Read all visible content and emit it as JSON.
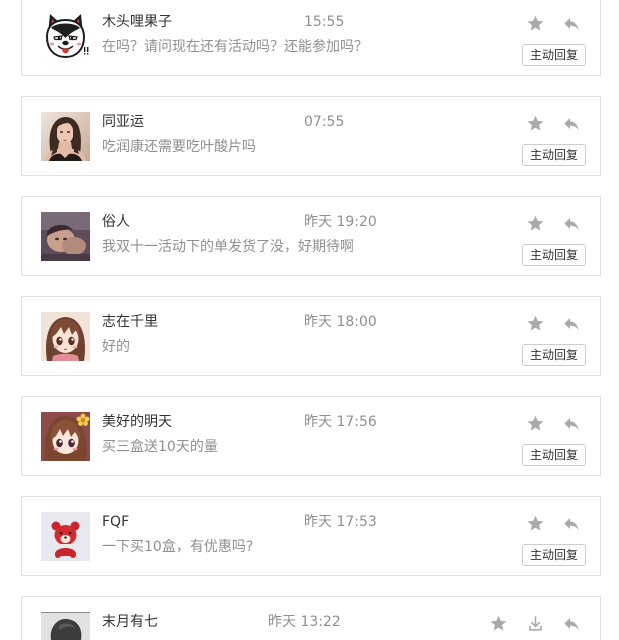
{
  "colors": {
    "card_border": "#e2e2e2",
    "name_text": "#333333",
    "time_text": "#909090",
    "message_text": "#909090",
    "icon": "#aaaaaa",
    "button_border": "#cccccc",
    "button_text": "#333333",
    "page_background": "#ffffff"
  },
  "messages": [
    {
      "name": "木头哩果子",
      "time": "15:55",
      "text": "在吗？请问现在还有活动吗？还能参加吗？",
      "actions": [
        "star-icon",
        "reply-icon"
      ],
      "reply_button": "主动回复"
    },
    {
      "name": "同亚运",
      "time": "07:55",
      "text": "吃润康还需要吃叶酸片吗",
      "actions": [
        "star-icon",
        "reply-icon"
      ],
      "reply_button": "主动回复"
    },
    {
      "name": "俗人",
      "time": "昨天 19:20",
      "text": "我双十一活动下的单发货了没，好期待啊",
      "actions": [
        "star-icon",
        "reply-icon"
      ],
      "reply_button": "主动回复"
    },
    {
      "name": "志在千里",
      "time": "昨天 18:00",
      "text": "好的",
      "actions": [
        "star-icon",
        "reply-icon"
      ],
      "reply_button": "主动回复"
    },
    {
      "name": "美好的明天",
      "time": "昨天 17:56",
      "text": "买三盒送10天的量",
      "actions": [
        "star-icon",
        "reply-icon"
      ],
      "reply_button": "主动回复"
    },
    {
      "name": "FQF",
      "time": "昨天 17:53",
      "text": "一下买10盒，有优惠吗?",
      "actions": [
        "star-icon",
        "reply-icon"
      ],
      "reply_button": "主动回复"
    },
    {
      "name": "末月有七",
      "time": "昨天 13:22",
      "actions": [
        "star-icon",
        "download-icon",
        "reply-icon"
      ]
    }
  ]
}
